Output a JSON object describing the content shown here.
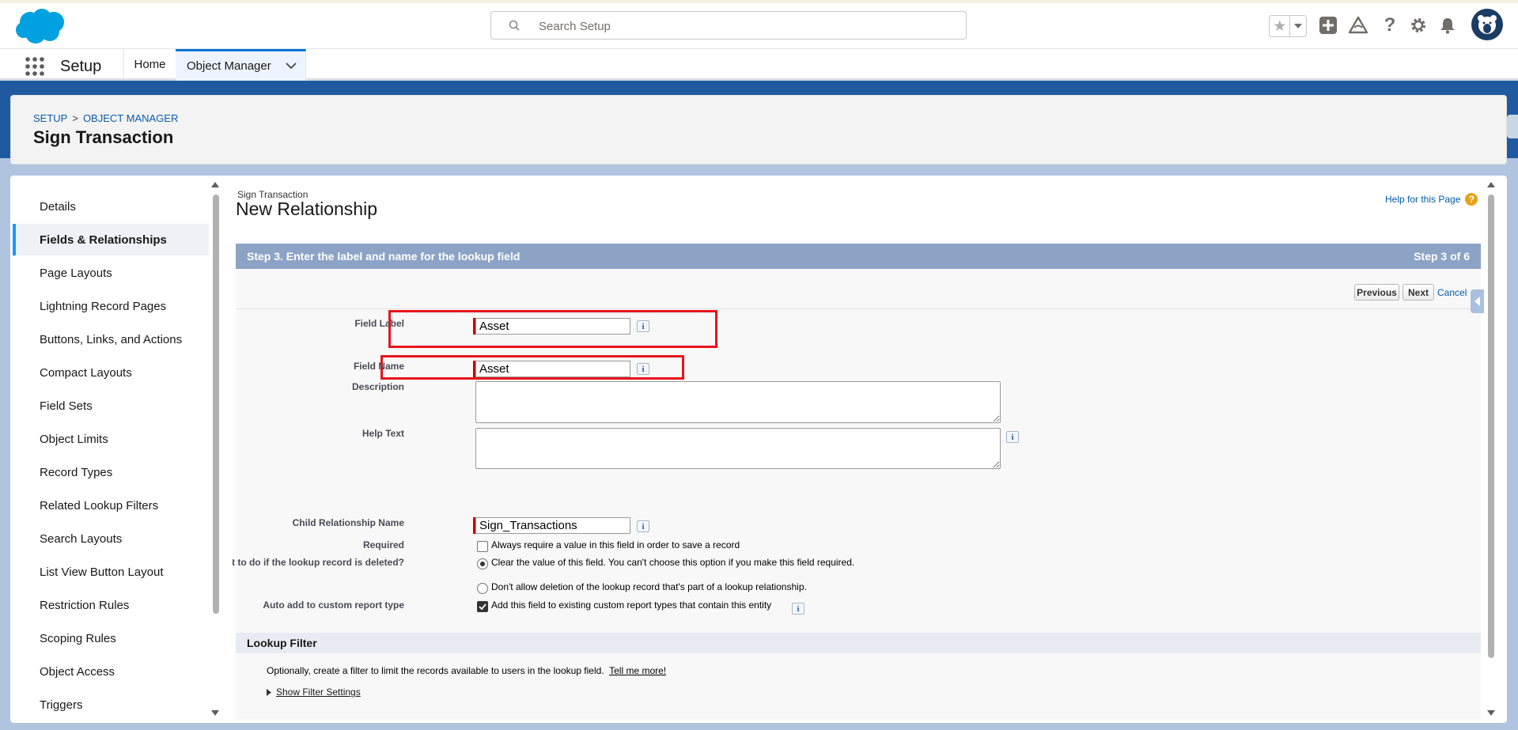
{
  "header": {
    "search_placeholder": "Search Setup",
    "icons": [
      "favorites-star-icon",
      "favorites-dropdown-icon",
      "global-actions-add-icon",
      "trailhead-icon",
      "help-icon",
      "setup-gear-icon",
      "notifications-bell-icon",
      "user-avatar"
    ],
    "brand_color": "#00a1e0"
  },
  "app_nav": {
    "app_name": "Setup",
    "tabs": [
      {
        "label": "Home"
      },
      {
        "label": "Object Manager"
      }
    ]
  },
  "page_header": {
    "breadcrumb": [
      "SETUP",
      "OBJECT MANAGER"
    ],
    "breadcrumb_sep": ">",
    "title": "Sign Transaction"
  },
  "sidebar": {
    "items": [
      {
        "label": "Details"
      },
      {
        "label": "Fields & Relationships"
      },
      {
        "label": "Page Layouts"
      },
      {
        "label": "Lightning Record Pages"
      },
      {
        "label": "Buttons, Links, and Actions"
      },
      {
        "label": "Compact Layouts"
      },
      {
        "label": "Field Sets"
      },
      {
        "label": "Object Limits"
      },
      {
        "label": "Record Types"
      },
      {
        "label": "Related Lookup Filters"
      },
      {
        "label": "Search Layouts"
      },
      {
        "label": "List View Button Layout"
      },
      {
        "label": "Restriction Rules"
      },
      {
        "label": "Scoping Rules"
      },
      {
        "label": "Object Access"
      },
      {
        "label": "Triggers"
      }
    ],
    "active_index": 1
  },
  "content": {
    "object_name": "Sign Transaction",
    "heading": "New Relationship",
    "help_link": "Help for this Page",
    "step_title": "Step 3. Enter the label and name for the lookup field",
    "step_counter": "Step 3 of 6",
    "buttons": {
      "previous": "Previous",
      "next": "Next",
      "cancel": "Cancel"
    },
    "fields": {
      "field_label": {
        "label": "Field Label",
        "value": "Asset"
      },
      "field_name": {
        "label": "Field Name",
        "value": "Asset"
      },
      "description": {
        "label": "Description",
        "value": ""
      },
      "help_text": {
        "label": "Help Text",
        "value": ""
      },
      "child_relationship": {
        "label": "Child Relationship Name",
        "value": "Sign_Transactions"
      },
      "required": {
        "label": "Required",
        "option": "Always require a value in this field in order to save a record",
        "checked": false
      },
      "on_delete": {
        "label": "What to do if the lookup record is deleted?",
        "options": [
          {
            "text": "Clear the value of this field. You can't choose this option if you make this field required.",
            "selected": true
          },
          {
            "text": "Don't allow deletion of the lookup record that's part of a lookup relationship.",
            "selected": false
          }
        ]
      },
      "auto_add": {
        "label": "Auto add to custom report type",
        "option": "Add this field to existing custom report types that contain this entity",
        "checked": true
      }
    },
    "lookup_filter": {
      "title": "Lookup Filter",
      "text": "Optionally, create a filter to limit the records available to users in the lookup field.",
      "tell_more": "Tell me more!",
      "show_settings": "Show Filter Settings"
    },
    "highlight_color": "#e8141b"
  }
}
